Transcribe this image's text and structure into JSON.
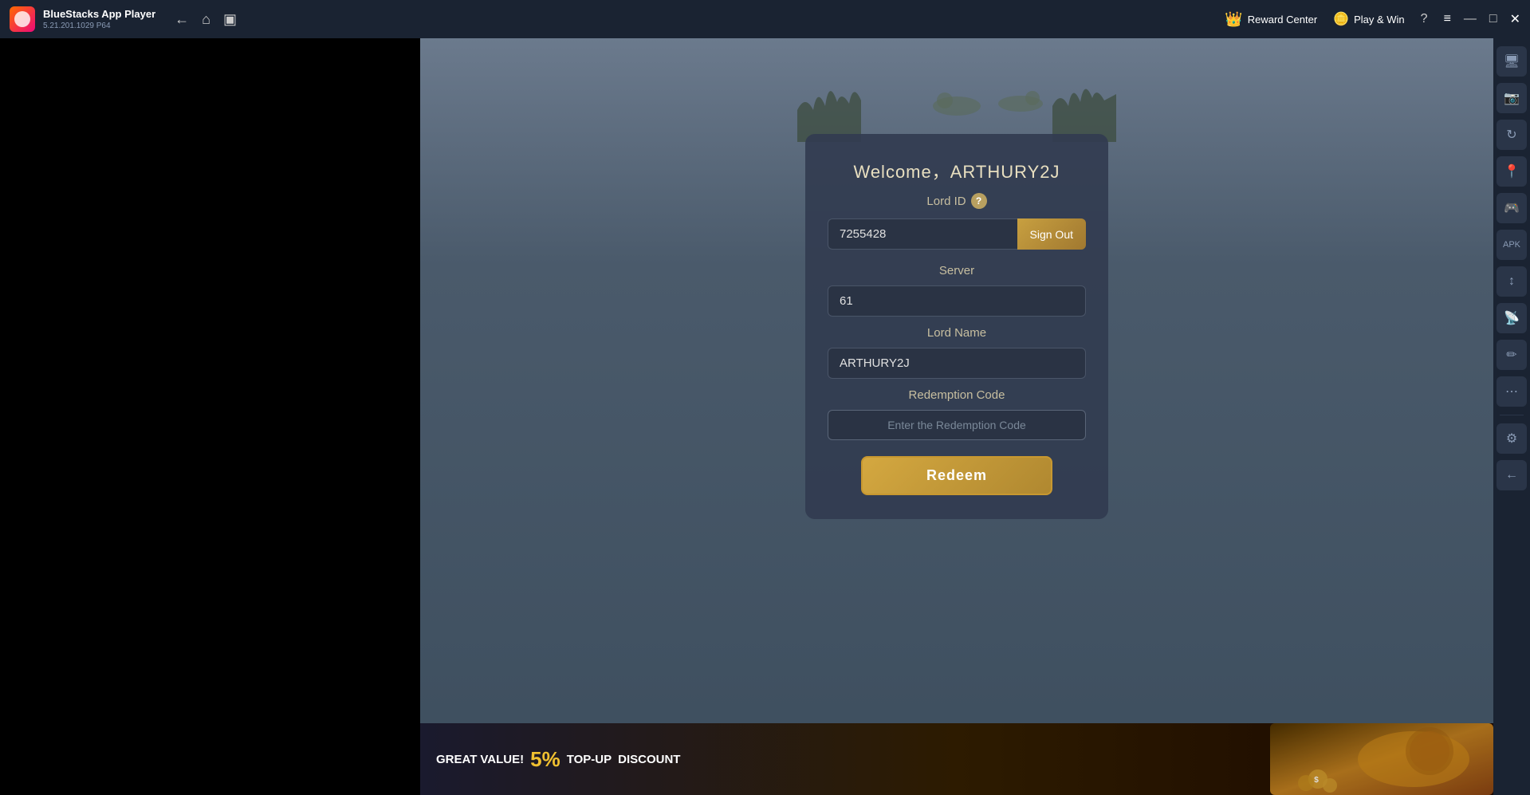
{
  "titlebar": {
    "app_name": "BlueStacks App Player",
    "version": "5.21.201.1029  P64",
    "logo_emoji": "🎮",
    "back_icon": "←",
    "home_icon": "⌂",
    "window_icon": "▣",
    "reward_center_label": "Reward Center",
    "reward_icon": "👑",
    "playnwin_label": "Play & Win",
    "playnwin_icon": "🪙",
    "help_icon": "?",
    "menu_icon": "≡",
    "minimize_icon": "—",
    "maximize_icon": "□",
    "close_icon": "✕"
  },
  "card": {
    "welcome_text": "Welcome，ARTHURY2J",
    "lord_id_label": "Lord ID",
    "lord_id_value": "7255428",
    "sign_out_label": "Sign Out",
    "server_label": "Server",
    "server_value": "61",
    "lord_name_label": "Lord Name",
    "lord_name_value": "ARTHURY2J",
    "redemption_code_label": "Redemption Code",
    "redemption_placeholder": "Enter the Redemption Code",
    "redeem_label": "Redeem"
  },
  "banner": {
    "great_value": "GREAT",
    "value_label": "VALUE!",
    "percent": "5%",
    "top_up": "TOP-UP",
    "discount": "DISCOUNT"
  },
  "sidebar": {
    "icons": [
      "🖥️",
      "📷",
      "↻",
      "📍",
      "🎮",
      "📦",
      "↕",
      "📡",
      "✏",
      "⋯",
      "⚙",
      "←"
    ]
  }
}
